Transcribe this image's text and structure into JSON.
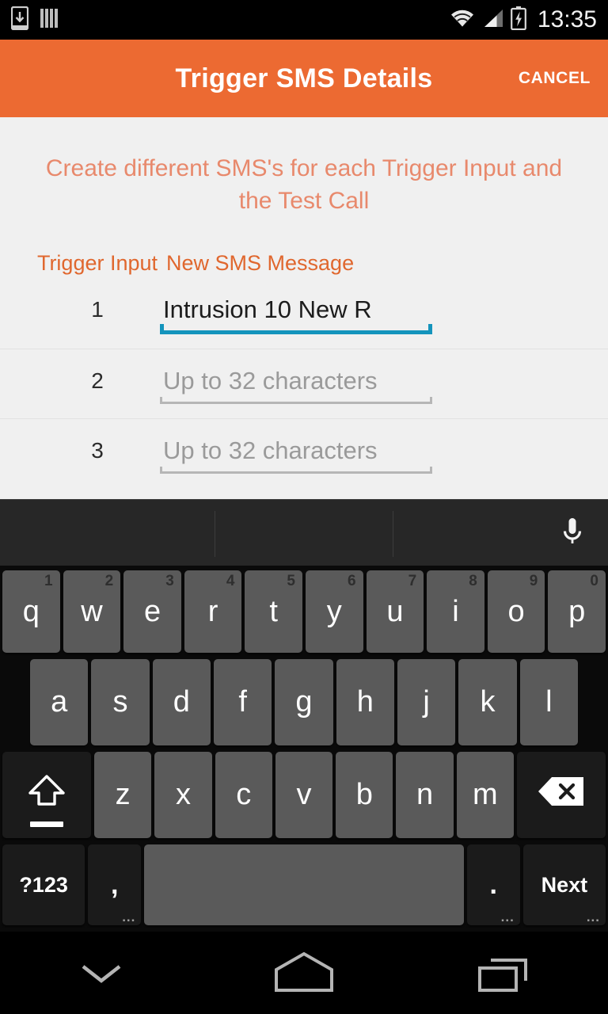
{
  "status_bar": {
    "icons": [
      "download-to-device-icon",
      "vertical-bars-icon"
    ],
    "wifi_icon": "wifi-icon",
    "signal_icon": "cellular-signal-icon",
    "battery_icon": "battery-charging-icon",
    "time": "13:35"
  },
  "app_bar": {
    "title": "Trigger SMS Details",
    "cancel_label": "CANCEL",
    "background_color": "#ec6a32"
  },
  "content": {
    "subtitle": "Create different SMS's for each Trigger Input and the Test Call",
    "subtitle_color": "#e8896c",
    "accent_color": "#e0672e",
    "focus_color": "#1494bc",
    "columns": {
      "trigger_input": "Trigger Input",
      "new_sms_message": "New SMS Message"
    },
    "rows": [
      {
        "index": "1",
        "value": "Intrusion 10 New R",
        "placeholder": "Up to 32 characters",
        "focused": true
      },
      {
        "index": "2",
        "value": "",
        "placeholder": "Up to 32 characters",
        "focused": false
      },
      {
        "index": "3",
        "value": "",
        "placeholder": "Up to 32 characters",
        "focused": false
      }
    ]
  },
  "keyboard": {
    "mic_icon": "microphone-icon",
    "row1": [
      {
        "label": "q",
        "hint": "1"
      },
      {
        "label": "w",
        "hint": "2"
      },
      {
        "label": "e",
        "hint": "3"
      },
      {
        "label": "r",
        "hint": "4"
      },
      {
        "label": "t",
        "hint": "5"
      },
      {
        "label": "y",
        "hint": "6"
      },
      {
        "label": "u",
        "hint": "7"
      },
      {
        "label": "i",
        "hint": "8"
      },
      {
        "label": "o",
        "hint": "9"
      },
      {
        "label": "p",
        "hint": "0"
      }
    ],
    "row2": [
      {
        "label": "a"
      },
      {
        "label": "s"
      },
      {
        "label": "d"
      },
      {
        "label": "f"
      },
      {
        "label": "g"
      },
      {
        "label": "h"
      },
      {
        "label": "j"
      },
      {
        "label": "k"
      },
      {
        "label": "l"
      }
    ],
    "row3": [
      {
        "label": "z"
      },
      {
        "label": "x"
      },
      {
        "label": "c"
      },
      {
        "label": "v"
      },
      {
        "label": "b"
      },
      {
        "label": "n"
      },
      {
        "label": "m"
      }
    ],
    "shift_icon": "shift-arrow-icon",
    "backspace_icon": "backspace-icon",
    "symbols_label": "?123",
    "comma_label": ",",
    "comma_dots": "...",
    "space_label": "",
    "period_label": ".",
    "period_dots": "...",
    "next_label": "Next",
    "next_dots": "...",
    "key_color": "#5a5a5a",
    "func_key_color": "#1b1b1b"
  },
  "nav_bar": {
    "back_icon": "keyboard-dismiss-chevron-icon",
    "home_icon": "home-icon",
    "recents_icon": "recent-apps-icon"
  }
}
